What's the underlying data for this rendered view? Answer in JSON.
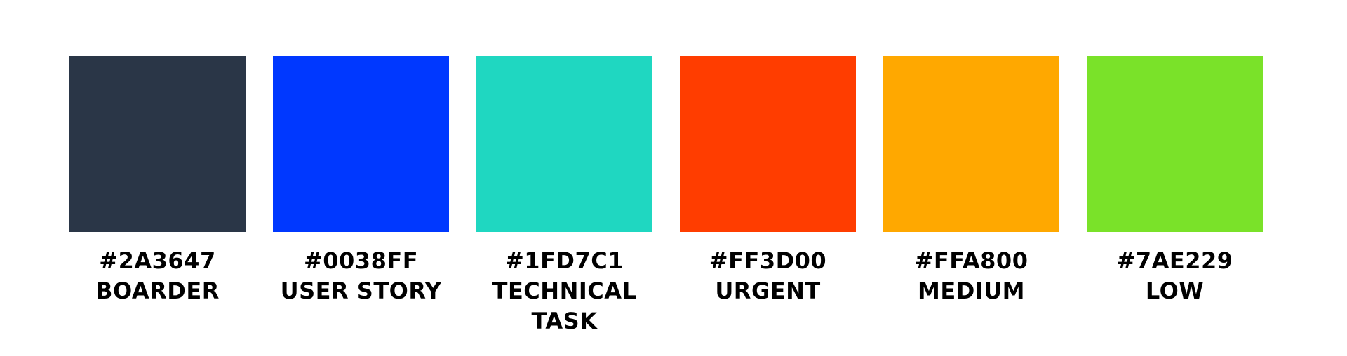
{
  "swatches": [
    {
      "hex": "#2A3647",
      "label": "BOARDER",
      "color": "#2A3647"
    },
    {
      "hex": "#0038FF",
      "label": "USER STORY",
      "color": "#0038FF"
    },
    {
      "hex": "#1FD7C1",
      "label": "TECHNICAL TASK",
      "color": "#1FD7C1"
    },
    {
      "hex": "#FF3D00",
      "label": "URGENT",
      "color": "#FF3D00"
    },
    {
      "hex": "#FFA800",
      "label": "MEDIUM",
      "color": "#FFA800"
    },
    {
      "hex": "#7AE229",
      "label": "LOW",
      "color": "#7AE229"
    }
  ]
}
